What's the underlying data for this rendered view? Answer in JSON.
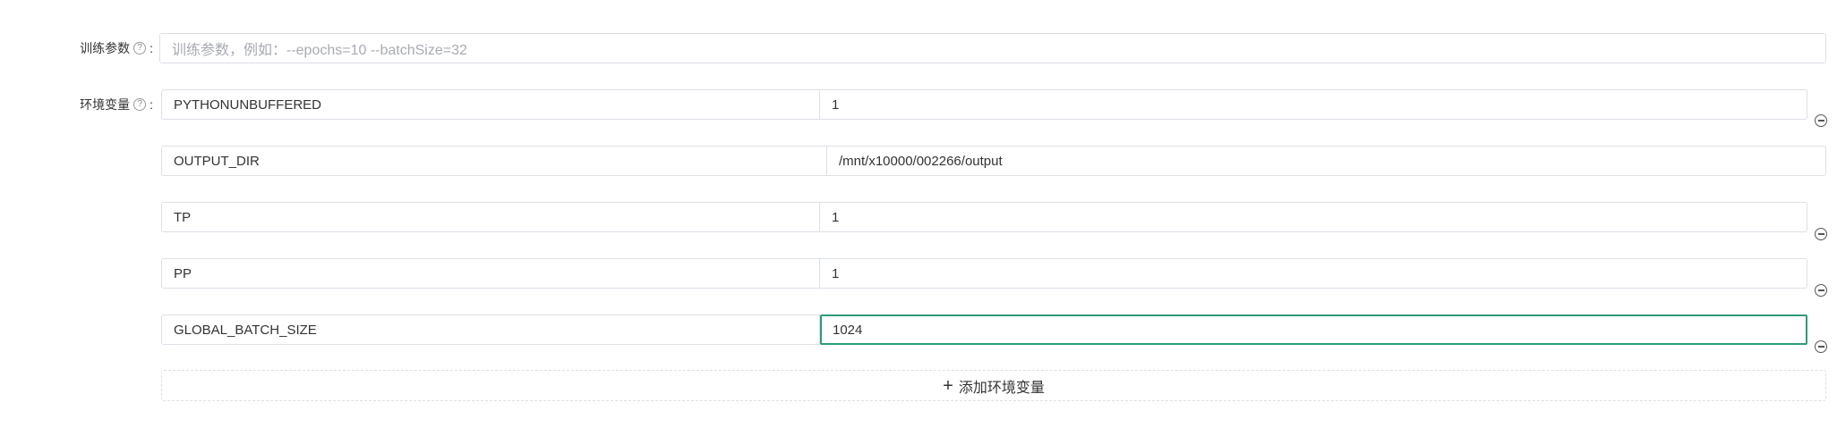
{
  "train_params": {
    "label": "训练参数",
    "colon": ":",
    "placeholder": "训练参数，例如：--epochs=10 --batchSize=32",
    "value": ""
  },
  "env_vars": {
    "label": "环境变量",
    "colon": ":",
    "rows": [
      {
        "key": "PYTHONUNBUFFERED",
        "value": "1"
      },
      {
        "key": "OUTPUT_DIR",
        "value": "/mnt/x10000/002266/output"
      },
      {
        "key": "TP",
        "value": "1"
      },
      {
        "key": "PP",
        "value": "1"
      },
      {
        "key": "GLOBAL_BATCH_SIZE",
        "value": "1024"
      }
    ],
    "add_label": "添加环境变量"
  },
  "icons": {
    "help": "question-circle-icon",
    "remove": "minus-circle-icon",
    "add": "plus-icon"
  },
  "colors": {
    "focus_border": "#2e9b7a",
    "border": "#dcdfe6",
    "placeholder": "#a8abb2"
  }
}
